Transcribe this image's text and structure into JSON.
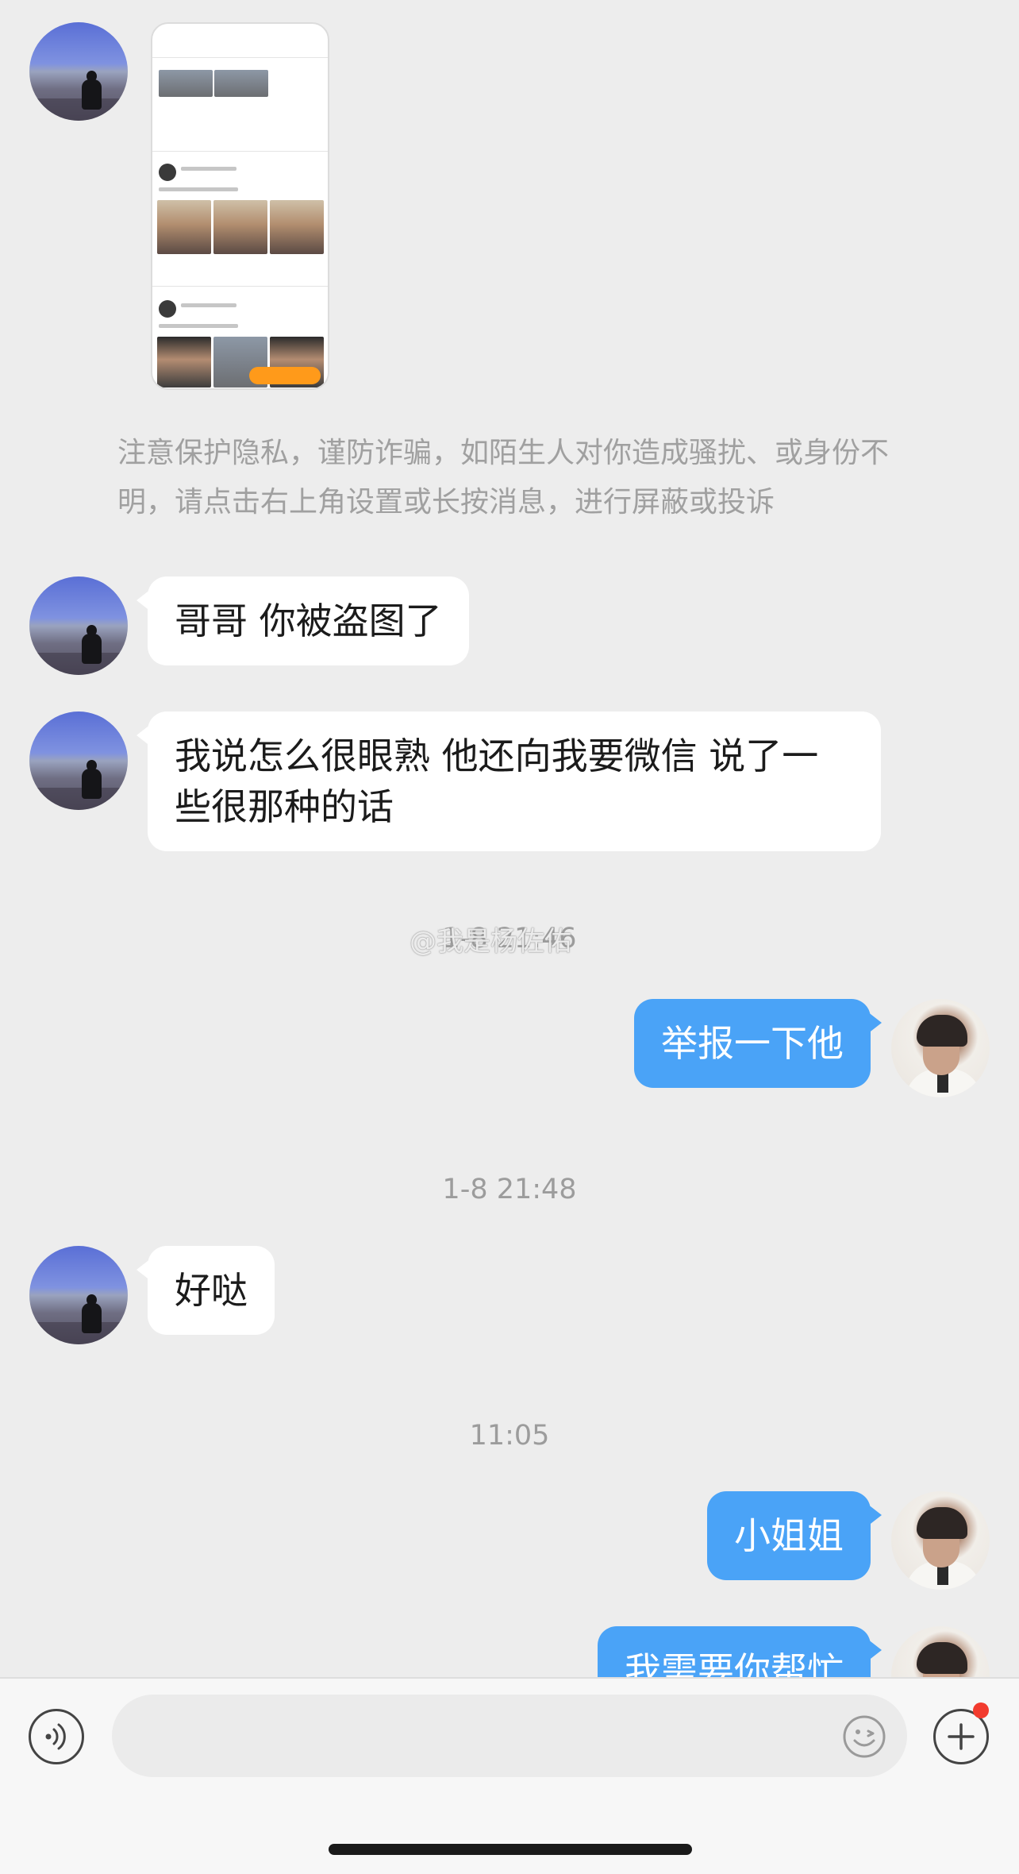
{
  "notice": "注意保护隐私，谨防诈骗，如陌生人对你造成骚扰、或身份不明，请点击右上角设置或长按消息，进行屏蔽或投诉",
  "messages": [
    {
      "from": "other",
      "text": "哥哥 你被盗图了"
    },
    {
      "from": "other",
      "text": "我说怎么很眼熟 他还向我要微信 说了一些很那种的话"
    },
    {
      "from": "me",
      "text": "举报一下他"
    },
    {
      "from": "other",
      "text": "好哒"
    },
    {
      "from": "me",
      "text": "小姐姐"
    },
    {
      "from": "me",
      "text": "我需要你帮忙"
    }
  ],
  "timestamps": {
    "t1": "1-8 21:46",
    "t2": "1-8 21:48",
    "t3": "11:05"
  },
  "watermark": "@我是杨佐佑",
  "icons": {
    "voice": "voice-icon",
    "emoji": "emoji-icon",
    "plus": "plus-icon"
  },
  "colors": {
    "outgoing_bubble": "#4aa3f7",
    "incoming_bubble": "#ffffff",
    "background": "#ededed",
    "badge": "#f23b2e"
  }
}
